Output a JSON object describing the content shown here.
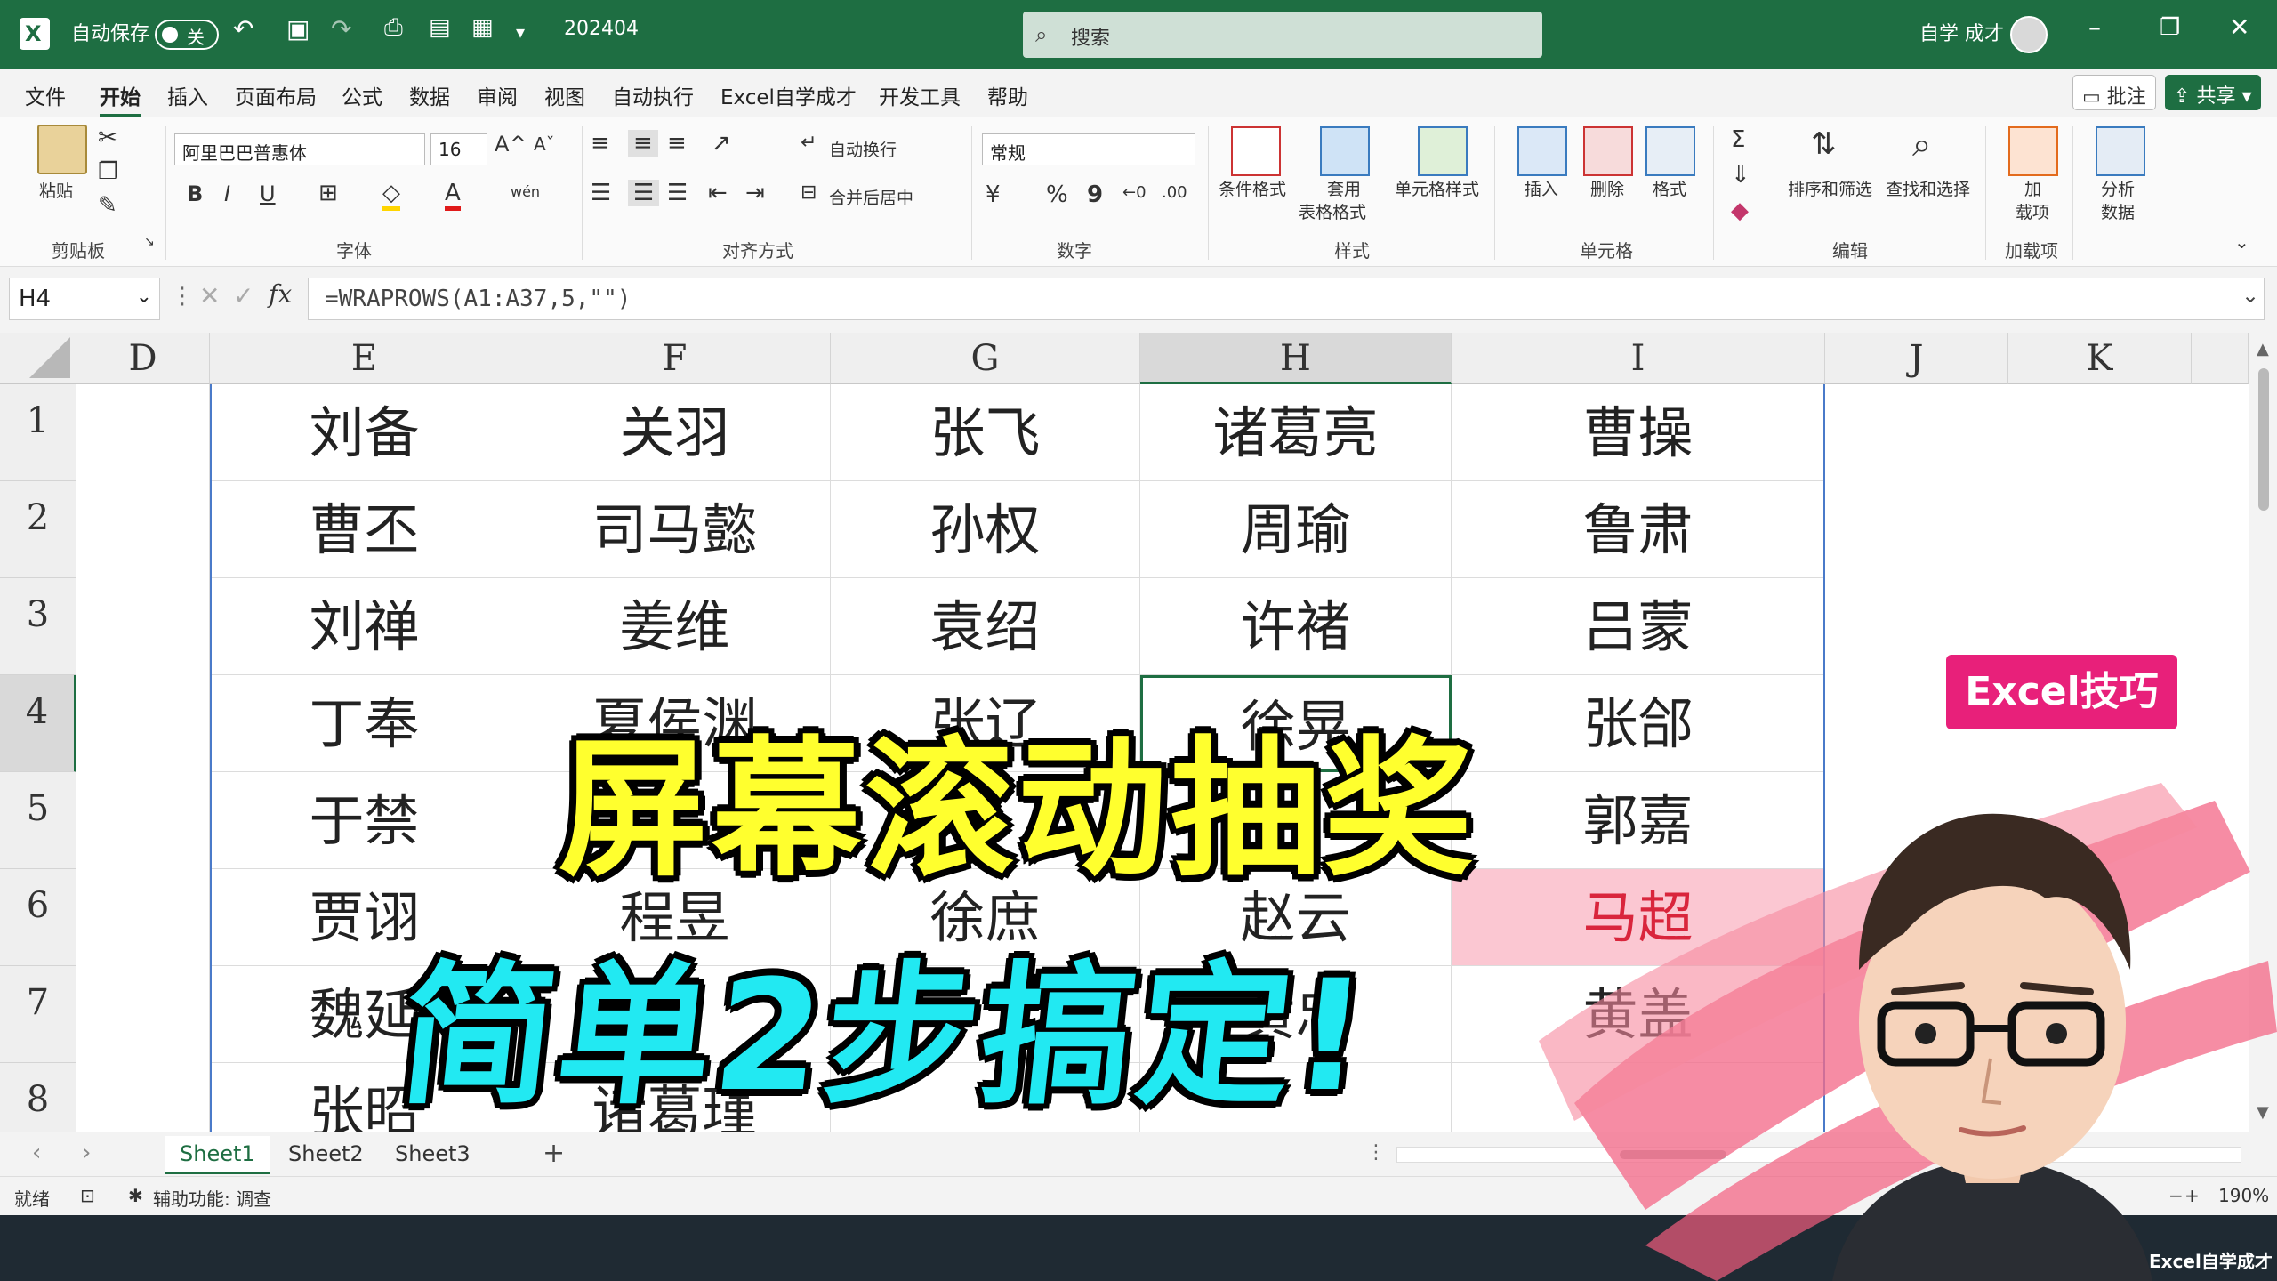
{
  "titlebar": {
    "autosave_label": "自动保存",
    "autosave_state": "关",
    "filename": "202404",
    "search_placeholder": "搜索",
    "user": "自学 成才"
  },
  "menu": {
    "items": [
      "文件",
      "开始",
      "插入",
      "页面布局",
      "公式",
      "数据",
      "审阅",
      "视图",
      "自动执行",
      "Excel自学成才",
      "开发工具",
      "帮助"
    ],
    "comment_label": "批注",
    "share_label": "共享"
  },
  "ribbon": {
    "clipboard": {
      "paste": "粘贴",
      "group": "剪贴板"
    },
    "font": {
      "name": "阿里巴巴普惠体",
      "size": "16",
      "group": "字体",
      "bold": "B",
      "italic": "I",
      "underline": "U",
      "increase": "A^",
      "decrease": "Aˇ",
      "phonetic": "wén"
    },
    "alignment": {
      "wrap": "自动换行",
      "merge": "合并后居中",
      "group": "对齐方式"
    },
    "number": {
      "format": "常规",
      "percent": "%",
      "comma": "9",
      "group": "数字"
    },
    "styles": {
      "conditional": "条件格式",
      "table_1": "套用",
      "table_2": "表格格式",
      "cell_styles": "单元格样式",
      "group": "样式"
    },
    "cells": {
      "insert": "插入",
      "delete": "删除",
      "format": "格式",
      "group": "单元格"
    },
    "editing": {
      "sort": "排序和筛选",
      "find": "查找和选择",
      "group": "编辑"
    },
    "addins": {
      "addin_1": "加",
      "addin_2": "载项",
      "group": "加载项"
    },
    "analysis": {
      "label_1": "分析",
      "label_2": "数据"
    }
  },
  "formula_bar": {
    "name_box": "H4",
    "fx": "fx",
    "formula": "=WRAPROWS(A1:A37,5,\"\")"
  },
  "grid": {
    "columns": [
      "D",
      "E",
      "F",
      "G",
      "H",
      "I",
      "J",
      "K"
    ],
    "selected_column": "H",
    "rows": [
      "1",
      "2",
      "3",
      "4",
      "5",
      "6",
      "7",
      "8"
    ],
    "selected_row": "4",
    "cells": [
      [
        "刘备",
        "关羽",
        "张飞",
        "诸葛亮",
        "曹操"
      ],
      [
        "曹丕",
        "司马懿",
        "孙权",
        "周瑜",
        "鲁肃"
      ],
      [
        "刘禅",
        "姜维",
        "袁绍",
        "许褚",
        "吕蒙"
      ],
      [
        "丁奉",
        "夏侯渊",
        "张辽",
        "徐晃",
        "张郃"
      ],
      [
        "于禁",
        "",
        "",
        "",
        "郭嘉"
      ],
      [
        "贾诩",
        "程昱",
        "徐庶",
        "赵云",
        "马超"
      ],
      [
        "魏延",
        "",
        "",
        "黄忠",
        "黄盖"
      ],
      [
        "张昭",
        "诸葛瑾",
        "",
        "",
        ""
      ]
    ]
  },
  "sheets": {
    "tabs": [
      "Sheet1",
      "Sheet2",
      "Sheet3"
    ],
    "active": "Sheet1",
    "add": "+"
  },
  "status": {
    "ready": "就绪",
    "accessibility": "辅助功能: 调查",
    "zoom": "190%"
  },
  "overlay": {
    "title": "屏幕滚动抽奖",
    "subtitle": "简单2步搞定!",
    "tag": "Excel技巧",
    "brand": "Excel自学成才",
    "colors": {
      "title": "#ffff2e",
      "subtitle": "#22e9f2",
      "tag": "#e8207a"
    }
  }
}
